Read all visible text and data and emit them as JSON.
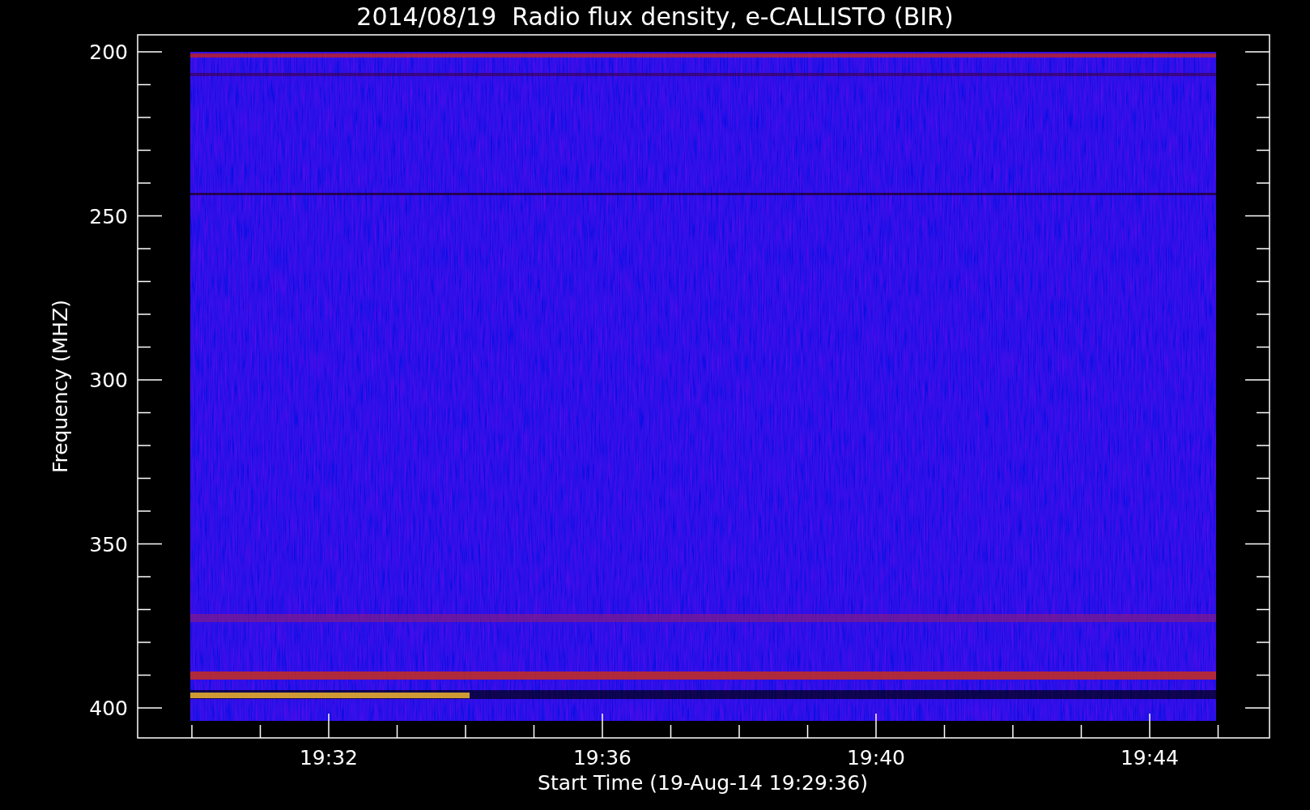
{
  "title": "2014/08/19  Radio flux density, e-CALLISTO (BIR)",
  "y_axis": {
    "label": "Frequency (MHZ)",
    "ticks": [
      "200",
      "250",
      "300",
      "350",
      "400"
    ]
  },
  "x_axis": {
    "label": "Start Time (19-Aug-14 19:29:36)",
    "ticks": [
      "19:32",
      "19:36",
      "19:40",
      "19:44"
    ]
  }
}
